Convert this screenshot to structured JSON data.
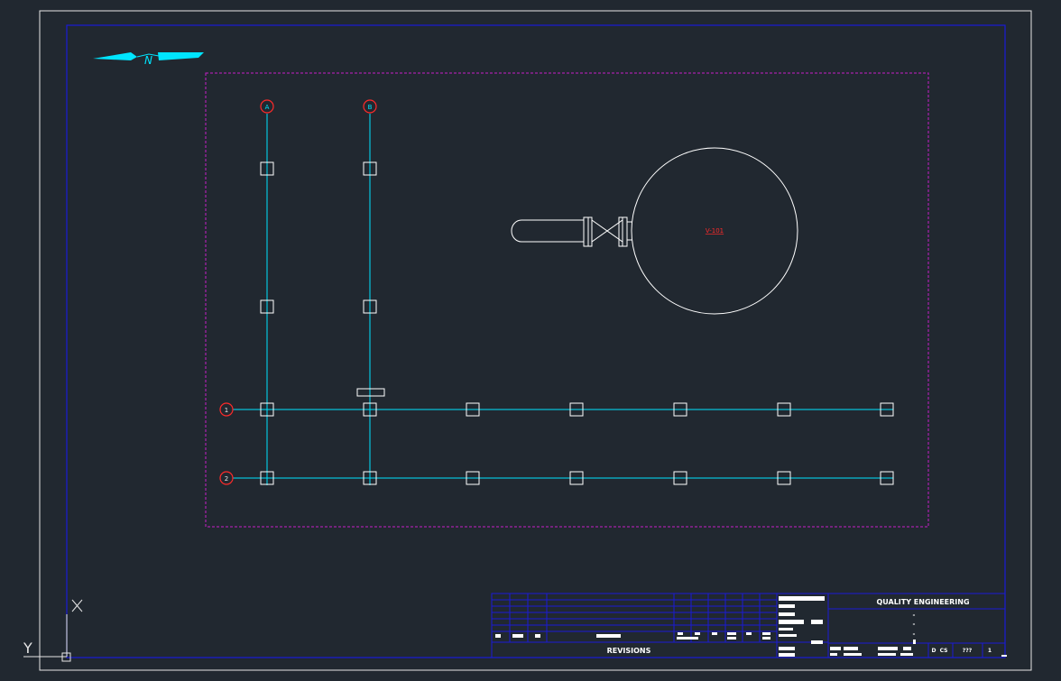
{
  "colors": {
    "background": "#212830",
    "sheet_border": "#e6e6e6",
    "drawing_frame": "#1a1ad6",
    "viewport": "#c81ec8",
    "grid_line": "#00e5ff",
    "grid_bubble": "#ff2a2a",
    "geometry": "#ffffff",
    "vessel_tag": "#ff2a2a"
  },
  "north_arrow": {
    "label": "N",
    "icon": "north-arrow-icon"
  },
  "grid": {
    "vertical_bubbles": [
      {
        "label": "A"
      },
      {
        "label": "B"
      }
    ],
    "horizontal_bubbles": [
      {
        "label": "1"
      },
      {
        "label": "2"
      }
    ]
  },
  "equipment": {
    "vessel_tag": "V-101"
  },
  "title_block": {
    "company": "QUALITY ENGINEERING",
    "revisions_label": "REVISIONS",
    "field_1": "D",
    "field_2": "CS",
    "field_3": "???",
    "field_4": "1",
    "dashes": [
      "-",
      "-",
      "-",
      "-"
    ]
  },
  "ucs": {
    "x_label": "X",
    "y_label": "Y"
  }
}
